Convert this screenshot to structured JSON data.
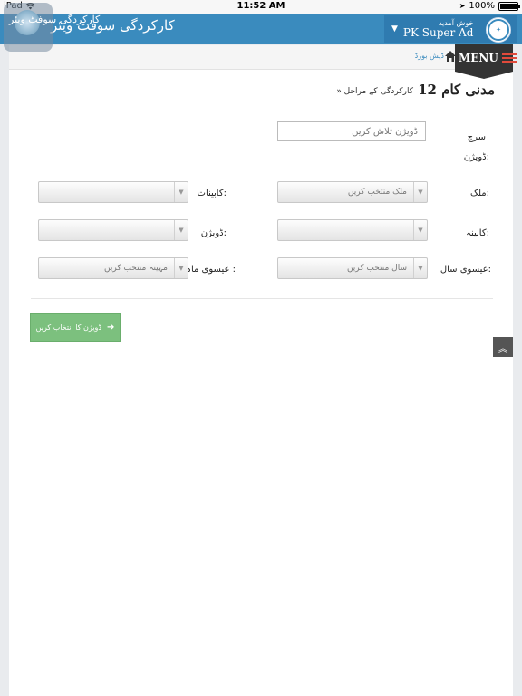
{
  "status_bar": {
    "device": "iPad",
    "time": "11:52 AM",
    "battery": "100%"
  },
  "header": {
    "app_title": "کارکردگی سوفٹ ویئر",
    "logo_text": "کارکردگی سوفٹ ویئر",
    "welcome": "خوش آمدید",
    "username": "PK Super Ad"
  },
  "breadcrumb": {
    "link": "ڈیش بورڈ",
    "menu_label": "MENU"
  },
  "page": {
    "heading": "12 مدنی کام",
    "sub_heading": "» کارکردگی کے مراحل"
  },
  "form": {
    "search_label": "سرچ",
    "division_label": "ڈویژن:",
    "search_placeholder": "ڈویژن تلاش کریں",
    "country_label": "ملک:",
    "country_placeholder": "ملک منتخب کریں",
    "continent_label": "کابینات:",
    "continent_value": "",
    "cabinet_label": "کابینہ:",
    "cabinet_value": "",
    "division2_label": "ڈویژن:",
    "division2_value": "",
    "year_label": "عیسوی سال:",
    "year_placeholder": "سال منتخب کریں",
    "month_label": "عیسوی ماہ :",
    "month_placeholder": "مہینہ منتخب کریں",
    "submit_label": "ڈویژن کا انتخاب کریں"
  },
  "colors": {
    "header_blue": "#3a8bbe",
    "button_green": "#7cc07e",
    "menu_accent": "#e14a3b"
  }
}
